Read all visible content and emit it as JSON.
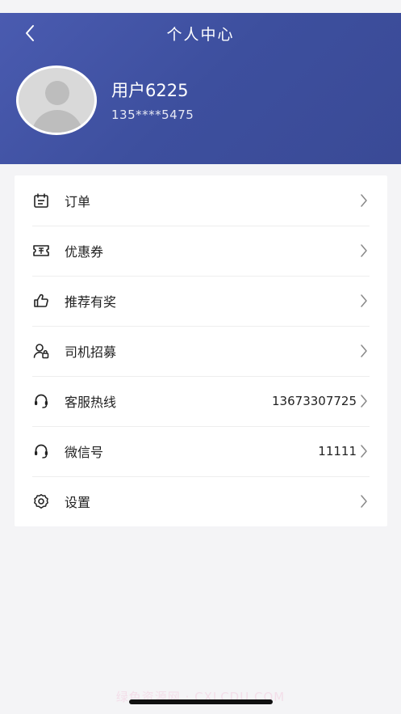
{
  "nav": {
    "title": "个人中心"
  },
  "user": {
    "name": "用户6225",
    "phone": "135****5475"
  },
  "menu": [
    {
      "label": "订单",
      "icon": "calendar-icon",
      "value": ""
    },
    {
      "label": "优惠券",
      "icon": "ticket-icon",
      "value": ""
    },
    {
      "label": "推荐有奖",
      "icon": "thumbs-up-icon",
      "value": ""
    },
    {
      "label": "司机招募",
      "icon": "user-lock-icon",
      "value": ""
    },
    {
      "label": "客服热线",
      "icon": "headset-icon",
      "value": "13673307725"
    },
    {
      "label": "微信号",
      "icon": "headset-icon",
      "value": "11111"
    },
    {
      "label": "设置",
      "icon": "gear-icon",
      "value": ""
    }
  ],
  "footer": {
    "watermark": "绿色资源网 · CXLCDU.COM"
  },
  "colors": {
    "header_start": "#4a5bb0",
    "header_end": "#3a4a96",
    "background": "#f4f4f6",
    "card": "#ffffff"
  }
}
